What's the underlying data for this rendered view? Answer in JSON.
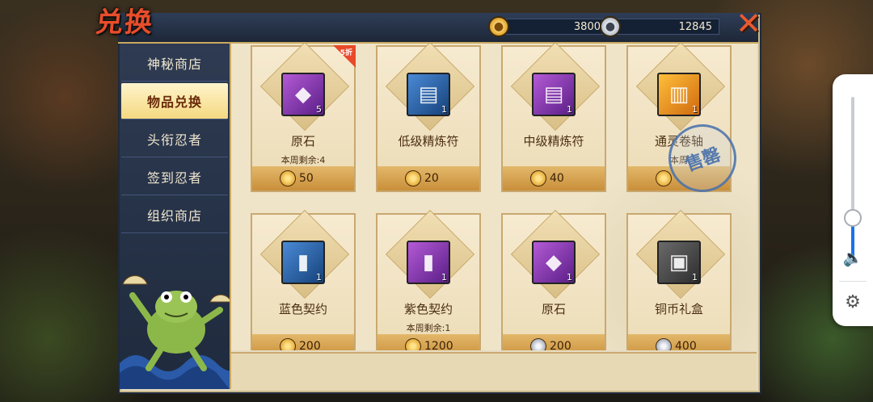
{
  "window": {
    "title": "兑换",
    "close_glyph": "✕"
  },
  "currencies": [
    {
      "type": "gold",
      "icon": "gold-coin-icon",
      "value": "3800"
    },
    {
      "type": "silver",
      "icon": "silver-coin-icon",
      "value": "12845"
    }
  ],
  "sidebar": {
    "items": [
      {
        "label": "神秘商店",
        "active": false
      },
      {
        "label": "物品兑换",
        "active": true
      },
      {
        "label": "头衔忍者",
        "active": false
      },
      {
        "label": "签到忍者",
        "active": false
      },
      {
        "label": "组织商店",
        "active": false
      }
    ]
  },
  "items": [
    {
      "name": "原石",
      "qty": "5",
      "weekly": "本周剩余:4",
      "price": "50",
      "currency": "gold",
      "icon": "ore-stone-icon",
      "quality": "purple",
      "tag": "5折",
      "sold_out": false
    },
    {
      "name": "低级精炼符",
      "qty": "1",
      "weekly": "",
      "price": "20",
      "currency": "gold",
      "icon": "refine-scroll-icon",
      "quality": "blue",
      "tag": "",
      "sold_out": false
    },
    {
      "name": "中级精炼符",
      "qty": "1",
      "weekly": "",
      "price": "40",
      "currency": "gold",
      "icon": "refine-scroll-icon",
      "quality": "purple",
      "tag": "",
      "sold_out": false
    },
    {
      "name": "通灵卷轴",
      "qty": "1",
      "weekly": "本周",
      "price": "",
      "currency": "gold",
      "icon": "summon-scroll-icon",
      "quality": "orange",
      "tag": "",
      "sold_out": true,
      "sold_out_label": "售罄"
    },
    {
      "name": "蓝色契约",
      "qty": "1",
      "weekly": "",
      "price": "200",
      "currency": "gold",
      "icon": "contract-scroll-icon",
      "quality": "blue",
      "tag": "",
      "sold_out": false
    },
    {
      "name": "紫色契约",
      "qty": "1",
      "weekly": "本周剩余:1",
      "price": "1200",
      "currency": "gold",
      "icon": "contract-scroll-icon",
      "quality": "purple",
      "tag": "",
      "sold_out": false
    },
    {
      "name": "原石",
      "qty": "1",
      "weekly": "",
      "price": "200",
      "currency": "silver",
      "icon": "ore-stone-icon",
      "quality": "purple",
      "tag": "",
      "sold_out": false
    },
    {
      "name": "铜币礼盒",
      "qty": "1",
      "weekly": "",
      "price": "400",
      "currency": "silver",
      "icon": "gift-box-icon",
      "quality": "gray",
      "tag": "",
      "sold_out": false
    }
  ],
  "volume": {
    "level": 0.27,
    "speaker_icon": "speaker-icon",
    "settings_icon": "gear-icon"
  }
}
